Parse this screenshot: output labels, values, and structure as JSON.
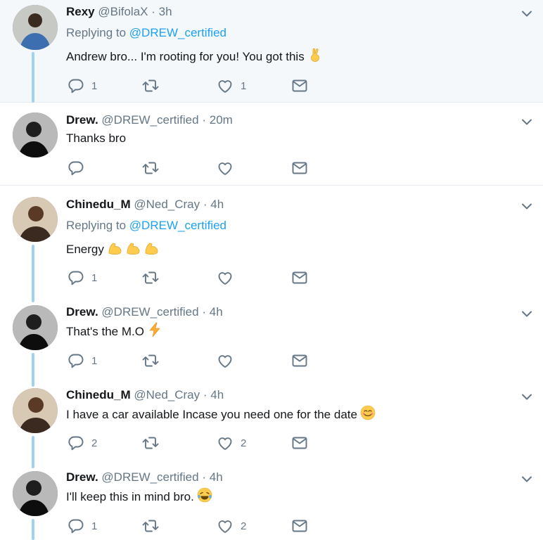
{
  "tweets": [
    {
      "name": "Rexy",
      "handle": "@BifolaX",
      "dot": "·",
      "time": "3h",
      "replying_prefix": "Replying to",
      "replying_to": "@DREW_certified",
      "text": "Andrew bro... I'm rooting for you! You got this",
      "emoji": "victory-hand",
      "reply_count": "1",
      "retweet_count": "",
      "like_count": "1"
    },
    {
      "name": "Drew.",
      "handle": "@DREW_certified",
      "dot": "·",
      "time": "20m",
      "text": "Thanks bro",
      "reply_count": "",
      "retweet_count": "",
      "like_count": ""
    },
    {
      "name": "Chinedu_M",
      "handle": "@Ned_Cray",
      "dot": "·",
      "time": "4h",
      "replying_prefix": "Replying to",
      "replying_to": "@DREW_certified",
      "text": "Energy",
      "emoji": "flexed-biceps-x3",
      "reply_count": "1",
      "retweet_count": "",
      "like_count": ""
    },
    {
      "name": "Drew.",
      "handle": "@DREW_certified",
      "dot": "·",
      "time": "4h",
      "text": "That's the M.O",
      "emoji": "lightning",
      "reply_count": "1",
      "retweet_count": "",
      "like_count": ""
    },
    {
      "name": "Chinedu_M",
      "handle": "@Ned_Cray",
      "dot": "·",
      "time": "4h",
      "text": "I have a car available Incase you need one for the date",
      "emoji": "smiling-face",
      "reply_count": "2",
      "retweet_count": "",
      "like_count": "2"
    },
    {
      "name": "Drew.",
      "handle": "@DREW_certified",
      "dot": "·",
      "time": "4h",
      "text": "I'll keep this in mind bro.",
      "emoji": "tears-of-joy",
      "reply_count": "1",
      "retweet_count": "",
      "like_count": "2"
    }
  ],
  "icons": {
    "reply": "reply-icon",
    "retweet": "retweet-icon",
    "like": "heart-icon",
    "dm": "envelope-icon",
    "caret": "chevron-down-icon"
  },
  "colors": {
    "link": "#1da1f2",
    "muted": "#657786",
    "text": "#14171a",
    "thread": "#9fd3ee",
    "highlight_bg": "#f5f8fa",
    "divider": "#e6ecf0"
  }
}
